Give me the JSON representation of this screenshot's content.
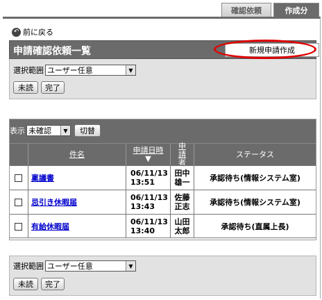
{
  "tabs": [
    {
      "label": "確認依頼",
      "active": false
    },
    {
      "label": "作成分",
      "active": true
    }
  ],
  "back": {
    "label": "前に戻る"
  },
  "header": {
    "title": "申請確認依頼一覧",
    "new_button": "新規申請作成"
  },
  "filter_top": {
    "label": "選択範囲",
    "selected": "ユーザー任意",
    "unread_button": "未読",
    "done_button": "完了"
  },
  "display": {
    "label": "表示",
    "selected": "未確認",
    "toggle_button": "切替"
  },
  "table": {
    "headers": {
      "name": "件名",
      "date": "申請日時",
      "sort_arrow": "▼",
      "applicant": "申請者",
      "status": "ステータス"
    },
    "rows": [
      {
        "name": "稟議書",
        "date": "06/11/13",
        "time": "13:51",
        "applicant_1": "田中",
        "applicant_2": "雄一",
        "status": "承認待ち(情報システム室)"
      },
      {
        "name": "忌引き休暇届",
        "date": "06/11/13",
        "time": "13:43",
        "applicant_1": "佐藤",
        "applicant_2": "正志",
        "status": "承認待ち(情報システム室)"
      },
      {
        "name": "有給休暇届",
        "date": "06/11/13",
        "time": "13:40",
        "applicant_1": "山田",
        "applicant_2": "太郎",
        "status": "承認待ち(直属上長)"
      }
    ]
  },
  "filter_bottom": {
    "label": "選択範囲",
    "selected": "ユーザー任意",
    "unread_button": "未読",
    "done_button": "完了"
  },
  "colors": {
    "header_bg": "#6b6b6b",
    "panel_bg": "#e2e2e2",
    "link": "#0000cc",
    "highlight": "#e00000"
  }
}
